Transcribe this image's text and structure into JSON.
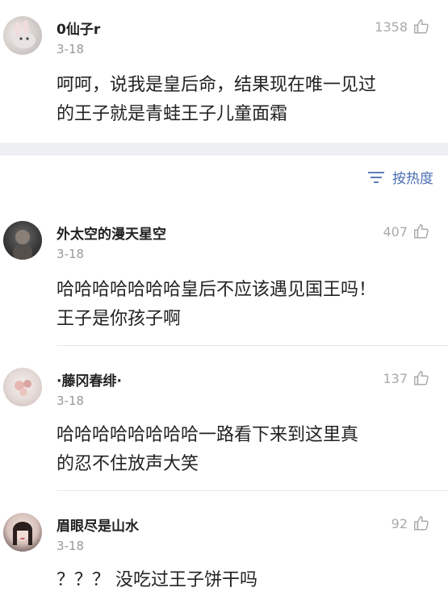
{
  "sort": {
    "icon": "sort-lines-icon",
    "label": "按热度"
  },
  "comments": [
    {
      "username": "0仙子r",
      "date": "3-18",
      "likes": "1358",
      "text_lines": [
        "呵呵，说我是皇后命，结果现在唯一见过",
        "的王子就是青蛙王子儿童面霜"
      ]
    },
    {
      "username": "外太空的漫天星空",
      "date": "3-18",
      "likes": "407",
      "text_lines": [
        "哈哈哈哈哈哈哈皇后不应该遇见国王吗！",
        "王子是你孩子啊"
      ]
    },
    {
      "username": "·藤冈春绯·",
      "date": "3-18",
      "likes": "137",
      "text_lines": [
        "哈哈哈哈哈哈哈哈一路看下来到这里真",
        "的忍不住放声大笑"
      ]
    },
    {
      "username": "眉眼尽是山水",
      "date": "3-18",
      "likes": "92",
      "text_lines": [
        "？？？ 没吃过王子饼干吗"
      ]
    }
  ],
  "colors": {
    "accent": "#4a6fb2",
    "muted": "#999999",
    "band": "#eeeff2"
  }
}
